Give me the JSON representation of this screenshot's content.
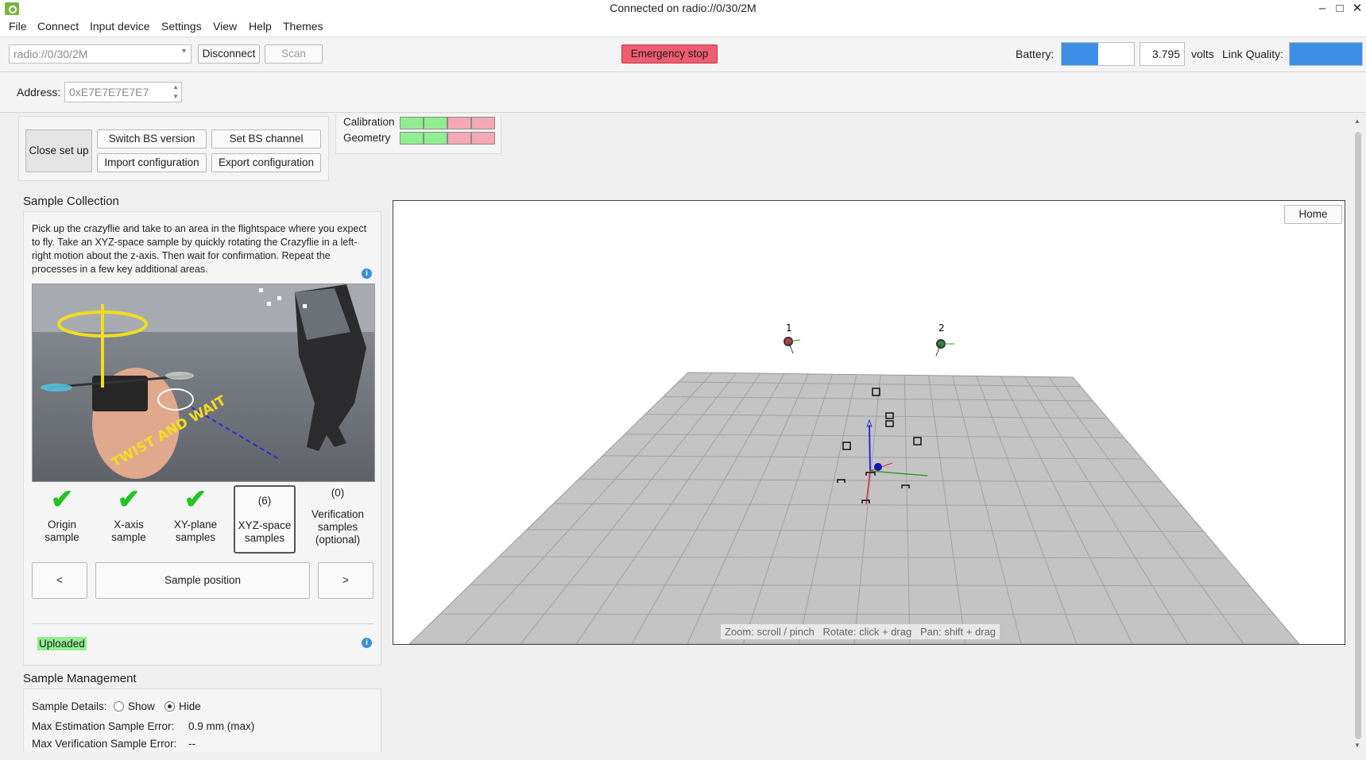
{
  "window": {
    "title": "Connected on radio://0/30/2M",
    "minimize": "–",
    "maximize": "□",
    "close": "✕"
  },
  "menu": {
    "items": [
      "File",
      "Connect",
      "Input device",
      "Settings",
      "View",
      "Help",
      "Themes"
    ]
  },
  "toolbar": {
    "uri_value": "radio://0/30/2M",
    "disconnect_label": "Disconnect",
    "scan_label": "Scan",
    "emergency_label": "Emergency stop",
    "battery_label": "Battery:",
    "battery_level": 0.5,
    "voltage": "3.795",
    "volts_label": "volts",
    "link_quality_label": "Link Quality:",
    "link_quality_level": 1.0,
    "accent": "#3d8fe6",
    "emergency_color": "#ef5d6f"
  },
  "address": {
    "label": "Address:",
    "value": "0xE7E7E7E7E7"
  },
  "basestation": {
    "close_setup": "Close set up",
    "switch_bs": "Switch BS version",
    "set_bs": "Set BS channel",
    "import": "Import configuration",
    "export": "Export configuration",
    "status_rows": [
      {
        "label": "Calibration",
        "cells": [
          "green",
          "green",
          "pink",
          "pink"
        ]
      },
      {
        "label": "Geometry",
        "cells": [
          "green",
          "green",
          "pink",
          "pink"
        ]
      }
    ]
  },
  "sample_collection": {
    "title": "Sample Collection",
    "instructions": "Pick up the crazyflie and take to an area in the flightspace where you expect to fly. Take an XYZ-space sample by quickly rotating the Crazyflie in a left-right motion about the z-axis. Then wait for confirmation. Repeat the processes in a few key additional areas.",
    "image_overlay_text": "TWIST AND WAIT",
    "steps": [
      {
        "status": "✔",
        "label": "Origin sample"
      },
      {
        "status": "✔",
        "label": "X-axis sample"
      },
      {
        "status": "✔",
        "label": "XY-plane samples"
      },
      {
        "status": "(6)",
        "label": "XYZ-space samples"
      },
      {
        "status": "(0)",
        "label": "Verification samples (optional)"
      }
    ],
    "prev_label": "<",
    "sample_label": "Sample position",
    "next_label": ">",
    "upload_status": "Uploaded"
  },
  "sample_management": {
    "title": "Sample Management",
    "details_label": "Sample Details:",
    "show_label": "Show",
    "hide_label": "Hide",
    "selected": "Hide",
    "max_est_label": "Max Estimation Sample Error:",
    "max_est_value": "0.9 mm (max)",
    "max_ver_label": "Max Verification Sample Error:",
    "max_ver_value": "--"
  },
  "viewer": {
    "home_label": "Home",
    "hint": "Zoom: scroll / pinch   Rotate: click + drag   Pan: shift + drag",
    "bs1_label": "1",
    "bs2_label": "2"
  }
}
